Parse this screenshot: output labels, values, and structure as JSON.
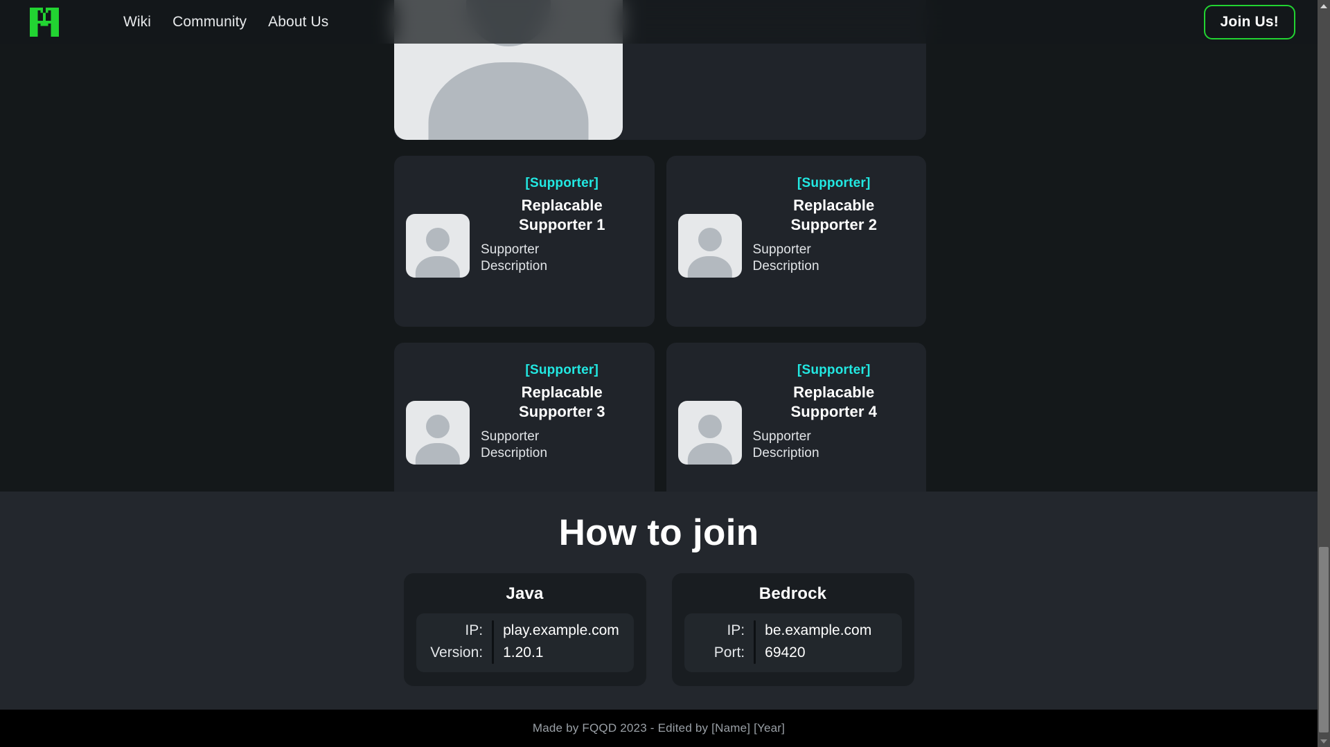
{
  "header": {
    "logo_name": "minecraft-m-logo",
    "logo_color": "#22d432",
    "nav": [
      {
        "label": "Wiki"
      },
      {
        "label": "Community"
      },
      {
        "label": "About Us"
      }
    ],
    "join_button": {
      "label": "Join Us!",
      "border_color": "#22d432"
    }
  },
  "supporters": {
    "tag_color": "#22e8e2",
    "featured": {
      "avatar_alt": "placeholder-person-avatar"
    },
    "cards": [
      {
        "tag": "[Supporter]",
        "name_line1": "Replacable",
        "name_line2": "Supporter 1",
        "desc_line1": "Supporter",
        "desc_line2": "Description",
        "avatar_alt": "placeholder-person-avatar"
      },
      {
        "tag": "[Supporter]",
        "name_line1": "Replacable",
        "name_line2": "Supporter 2",
        "desc_line1": "Supporter",
        "desc_line2": "Description",
        "avatar_alt": "placeholder-person-avatar"
      },
      {
        "tag": "[Supporter]",
        "name_line1": "Replacable",
        "name_line2": "Supporter 3",
        "desc_line1": "Supporter",
        "desc_line2": "Description",
        "avatar_alt": "placeholder-person-avatar"
      },
      {
        "tag": "[Supporter]",
        "name_line1": "Replacable",
        "name_line2": "Supporter 4",
        "desc_line1": "Supporter",
        "desc_line2": "Description",
        "avatar_alt": "placeholder-person-avatar"
      }
    ]
  },
  "how_to_join": {
    "title": "How to join",
    "java": {
      "title": "Java",
      "label_1": "IP:",
      "value_1": "play.example.com",
      "label_2": "Version:",
      "value_2": "1.20.1"
    },
    "bedrock": {
      "title": "Bedrock",
      "label_1": "IP:",
      "value_1": "be.example.com",
      "label_2": "Port:",
      "value_2": "69420"
    }
  },
  "footer": {
    "text": "Made by FQQD 2023 - Edited by [Name] [Year]"
  },
  "scrollbar": {
    "up_arrow": "scroll-up-arrow",
    "down_arrow": "scroll-down-arrow"
  }
}
